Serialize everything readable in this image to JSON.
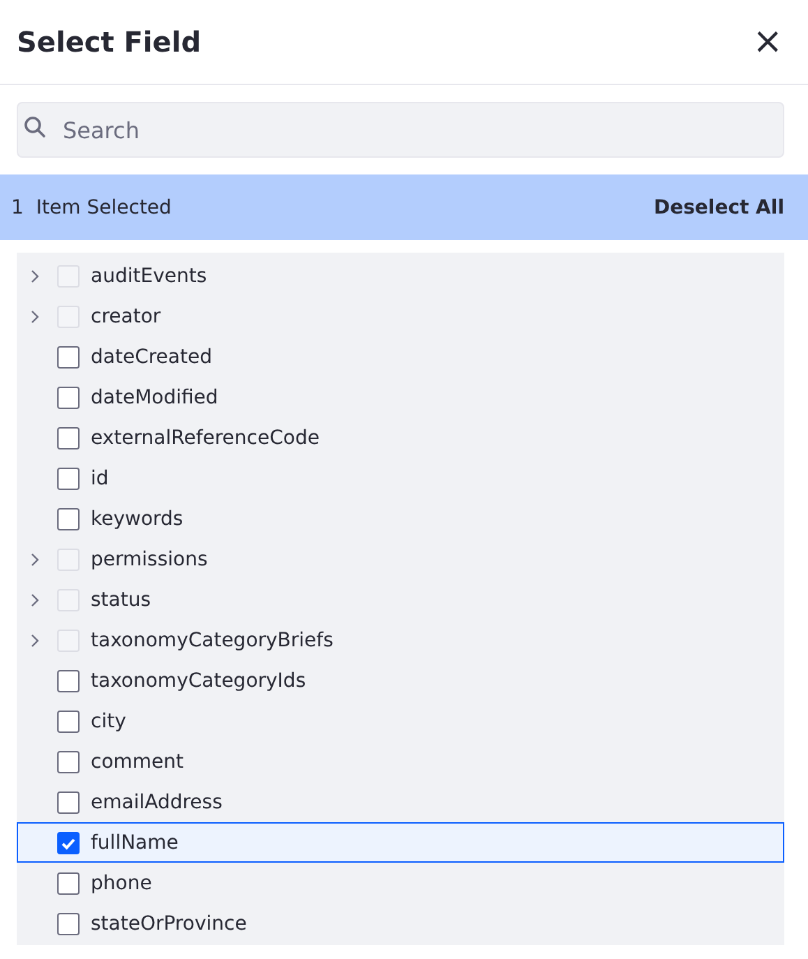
{
  "dialog": {
    "title": "Select Field",
    "close_label": "×"
  },
  "search": {
    "placeholder": "Search"
  },
  "selection_bar": {
    "count": "1",
    "label": "Item Selected",
    "action": "Deselect All"
  },
  "fields": [
    {
      "kind": "group",
      "name": "auditEvents",
      "checked": false
    },
    {
      "kind": "group",
      "name": "creator",
      "checked": false
    },
    {
      "kind": "field",
      "name": "dateCreated",
      "checked": false
    },
    {
      "kind": "field",
      "name": "dateModified",
      "checked": false
    },
    {
      "kind": "field",
      "name": "externalReferenceCode",
      "checked": false
    },
    {
      "kind": "field",
      "name": "id",
      "checked": false
    },
    {
      "kind": "field",
      "name": "keywords",
      "checked": false
    },
    {
      "kind": "group",
      "name": "permissions",
      "checked": false
    },
    {
      "kind": "group",
      "name": "status",
      "checked": false
    },
    {
      "kind": "group",
      "name": "taxonomyCategoryBriefs",
      "checked": false
    },
    {
      "kind": "field",
      "name": "taxonomyCategoryIds",
      "checked": false
    },
    {
      "kind": "field",
      "name": "city",
      "checked": false
    },
    {
      "kind": "field",
      "name": "comment",
      "checked": false
    },
    {
      "kind": "field",
      "name": "emailAddress",
      "checked": false
    },
    {
      "kind": "field",
      "name": "fullName",
      "checked": true
    },
    {
      "kind": "field",
      "name": "phone",
      "checked": false
    },
    {
      "kind": "field",
      "name": "stateOrProvince",
      "checked": false
    }
  ]
}
